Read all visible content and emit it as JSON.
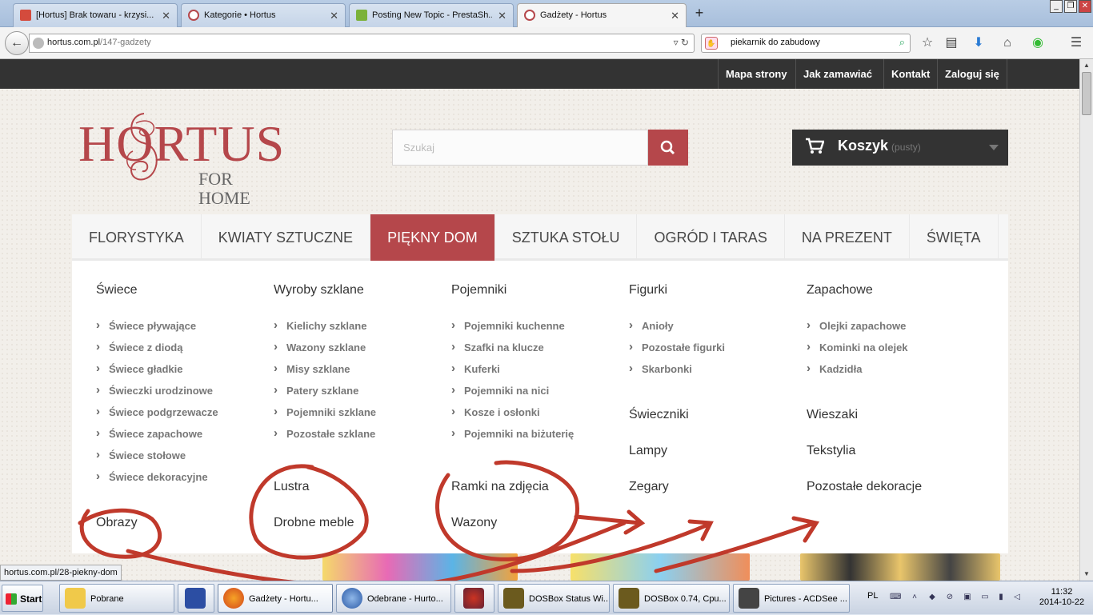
{
  "browser": {
    "tabs": [
      {
        "title": "[Hortus] Brak towaru - krzysi...",
        "icon": "gmail-icon",
        "color": "#d44b3d"
      },
      {
        "title": "Kategorie • Hortus",
        "icon": "hortus-icon",
        "color": "#b5474b"
      },
      {
        "title": "Posting New Topic - PrestaSh...",
        "icon": "prestashop-icon",
        "color": "#7bb23a"
      },
      {
        "title": "Gadżety - Hortus",
        "icon": "hortus-icon",
        "color": "#b5474b"
      }
    ],
    "url_domain": "hortus.com.pl",
    "url_path": "/147-gadzety",
    "search_value": "piekarnik do zabudowy",
    "status_url": "hortus.com.pl/28-piekny-dom"
  },
  "site": {
    "topnav": [
      "Mapa strony",
      "Jak zamawiać",
      "Kontakt",
      "Zaloguj się"
    ],
    "logo": {
      "main": "HORTUS",
      "sub": "FOR HOME"
    },
    "search_placeholder": "Szukaj",
    "cart": {
      "label": "Koszyk",
      "status": "(pusty)"
    },
    "menu": [
      "FLORYSTYKA",
      "KWIATY SZTUCZNE",
      "PIĘKNY DOM",
      "SZTUKA STOŁU",
      "OGRÓD I TARAS",
      "NA PREZENT",
      "ŚWIĘTA"
    ],
    "active_menu": "PIĘKNY DOM",
    "dropdown": {
      "col1": {
        "swiece": {
          "title": "Świece",
          "items": [
            "Świece pływające",
            "Świece z diodą",
            "Świece gładkie",
            "Świeczki urodzinowe",
            "Świece podgrzewacze",
            "Świece zapachowe",
            "Świece stołowe",
            "Świece dekoracyjne"
          ]
        },
        "obrazy": "Obrazy"
      },
      "col2": {
        "szklo": {
          "title": "Wyroby szklane",
          "items": [
            "Kielichy szklane",
            "Wazony szklane",
            "Misy szklane",
            "Patery szklane",
            "Pojemniki szklane",
            "Pozostałe szklane"
          ]
        },
        "lustra": "Lustra",
        "meble": "Drobne meble"
      },
      "col3": {
        "pojemniki": {
          "title": "Pojemniki",
          "items": [
            "Pojemniki kuchenne",
            "Szafki na klucze",
            "Kuferki",
            "Pojemniki na nici",
            "Kosze i osłonki",
            "Pojemniki na biżuterię"
          ]
        },
        "ramki": "Ramki na zdjęcia",
        "wazony": "Wazony"
      },
      "col4": {
        "figurki": {
          "title": "Figurki",
          "items": [
            "Anioły",
            "Pozostałe figurki",
            "Skarbonki"
          ]
        },
        "swieczniki": "Świeczniki",
        "lampy": "Lampy",
        "zegary": "Zegary"
      },
      "col5": {
        "zapachowe": {
          "title": "Zapachowe",
          "items": [
            "Olejki zapachowe",
            "Kominki na olejek",
            "Kadzidła"
          ]
        },
        "wieszaki": "Wieszaki",
        "tekstylia": "Tekstylia",
        "pozostale": "Pozostałe dekoracje"
      }
    }
  },
  "taskbar": {
    "start": "Start",
    "tasks": [
      {
        "label": "Pobrane",
        "icon": "folder-icon"
      },
      {
        "label": "",
        "icon": "floppy-icon"
      },
      {
        "label": "Gadżety - Hortu...",
        "icon": "firefox-icon"
      },
      {
        "label": "Odebrane - Hurto...",
        "icon": "thunderbird-icon"
      },
      {
        "label": "",
        "icon": "atom-icon"
      },
      {
        "label": "DOSBox Status Wi...",
        "icon": "dosbox-icon"
      },
      {
        "label": "DOSBox 0.74, Cpu...",
        "icon": "dosbox-icon"
      },
      {
        "label": "Pictures - ACDSee ...",
        "icon": "camera-icon"
      }
    ],
    "lang": "PL",
    "time": "11:32",
    "date": "2014-10-22"
  },
  "colors": {
    "accent": "#b5474b",
    "dark": "#333333",
    "scribble": "#c0392b"
  }
}
